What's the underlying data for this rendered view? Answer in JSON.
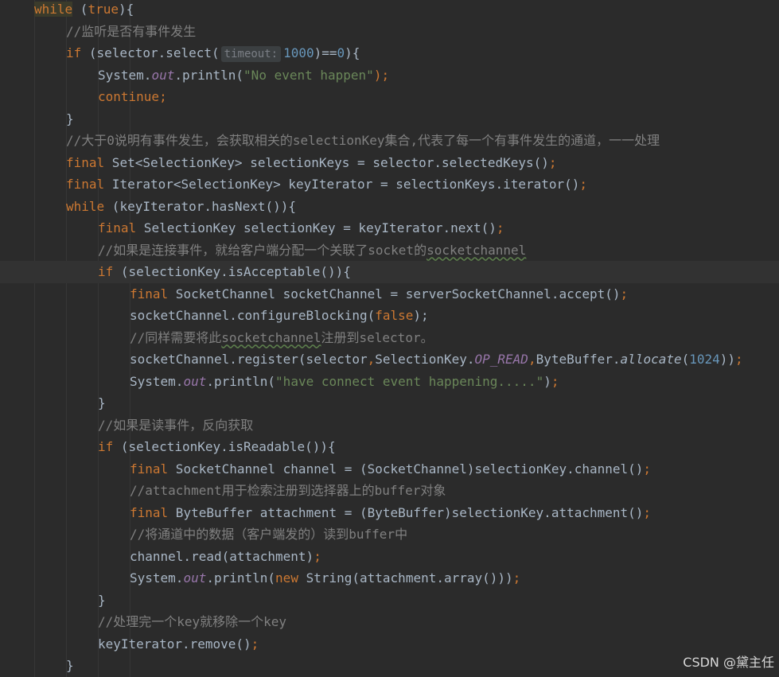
{
  "colors": {
    "background": "#2b2b2b",
    "keyword": "#cc7832",
    "string": "#6a8759",
    "number": "#6897bb",
    "comment": "#808080",
    "field": "#9876aa",
    "default": "#a9b7c6"
  },
  "watermark": "CSDN @黛主任",
  "lines": [
    {
      "indent": 1,
      "tokens": [
        {
          "t": "while",
          "c": "k kwhl"
        },
        {
          "t": " (",
          "c": ""
        },
        {
          "t": "true",
          "c": "k"
        },
        {
          "t": "){",
          "c": ""
        }
      ]
    },
    {
      "indent": 2,
      "tokens": [
        {
          "t": "//监听是否有事件发生",
          "c": "c"
        }
      ]
    },
    {
      "indent": 2,
      "tokens": [
        {
          "t": "if",
          "c": "k"
        },
        {
          "t": " (selector.select(",
          "c": ""
        },
        {
          "t": "timeout:",
          "c": "hint"
        },
        {
          "t": "1000",
          "c": "n"
        },
        {
          "t": ")==",
          "c": ""
        },
        {
          "t": "0",
          "c": "n"
        },
        {
          "t": "){",
          "c": ""
        }
      ]
    },
    {
      "indent": 3,
      "tokens": [
        {
          "t": "System.",
          "c": ""
        },
        {
          "t": "out",
          "c": "f"
        },
        {
          "t": ".println(",
          "c": ""
        },
        {
          "t": "\"No event happen\"",
          "c": "s"
        },
        {
          "t": ");",
          "c": "k"
        }
      ]
    },
    {
      "indent": 3,
      "tokens": [
        {
          "t": "continue",
          "c": "k"
        },
        {
          "t": ";",
          "c": "k"
        }
      ]
    },
    {
      "indent": 2,
      "tokens": [
        {
          "t": "}",
          "c": ""
        }
      ]
    },
    {
      "indent": 2,
      "tokens": [
        {
          "t": "//大于0说明有事件发生，会获取相关的selectionKey集合,代表了每一个有事件发生的通道，一一处理",
          "c": "c"
        }
      ]
    },
    {
      "indent": 2,
      "tokens": [
        {
          "t": "final",
          "c": "k"
        },
        {
          "t": " Set<SelectionKey> selectionKeys = selector.selectedKeys()",
          "c": ""
        },
        {
          "t": ";",
          "c": "k"
        }
      ]
    },
    {
      "indent": 2,
      "tokens": [
        {
          "t": "final",
          "c": "k"
        },
        {
          "t": " Iterator<SelectionKey> keyIterator = selectionKeys.iterator()",
          "c": ""
        },
        {
          "t": ";",
          "c": "k"
        }
      ]
    },
    {
      "indent": 2,
      "tokens": [
        {
          "t": "while",
          "c": "k"
        },
        {
          "t": " (keyIterator.hasNext()){",
          "c": ""
        }
      ]
    },
    {
      "indent": 3,
      "tokens": [
        {
          "t": "final",
          "c": "k"
        },
        {
          "t": " SelectionKey selectionKey = keyIterator.next()",
          "c": ""
        },
        {
          "t": ";",
          "c": "k"
        }
      ]
    },
    {
      "indent": 3,
      "tokens": [
        {
          "t": "//如果是连接事件，就给客户端分配一个关联了socket的",
          "c": "c"
        },
        {
          "t": "socketchannel",
          "c": "c typo"
        }
      ]
    },
    {
      "indent": 3,
      "current": true,
      "tokens": [
        {
          "t": "if",
          "c": "k"
        },
        {
          "t": " (selectionKey.isAcceptable()){",
          "c": ""
        }
      ]
    },
    {
      "indent": 4,
      "tokens": [
        {
          "t": "final",
          "c": "k"
        },
        {
          "t": " SocketChannel socketChannel = serverSocketChannel.accept()",
          "c": ""
        },
        {
          "t": ";",
          "c": "k"
        }
      ]
    },
    {
      "indent": 4,
      "tokens": [
        {
          "t": "socketChannel.configureBlocking(",
          "c": ""
        },
        {
          "t": "false",
          "c": "k"
        },
        {
          "t": ");",
          "c": ""
        }
      ]
    },
    {
      "indent": 4,
      "tokens": [
        {
          "t": "//同样需要将此",
          "c": "c"
        },
        {
          "t": "socketchannel",
          "c": "c typo"
        },
        {
          "t": "注册到selector。",
          "c": "c"
        }
      ]
    },
    {
      "indent": 4,
      "tokens": [
        {
          "t": "socketChannel.register(selector",
          "c": ""
        },
        {
          "t": ",",
          "c": "k"
        },
        {
          "t": "SelectionKey.",
          "c": ""
        },
        {
          "t": "OP_READ",
          "c": "sf"
        },
        {
          "t": ",",
          "c": "k"
        },
        {
          "t": "ByteBuffer.",
          "c": ""
        },
        {
          "t": "allocate",
          "c": "sm"
        },
        {
          "t": "(",
          "c": ""
        },
        {
          "t": "1024",
          "c": "n"
        },
        {
          "t": "))",
          "c": ""
        },
        {
          "t": ";",
          "c": "k"
        }
      ]
    },
    {
      "indent": 4,
      "tokens": [
        {
          "t": "System.",
          "c": ""
        },
        {
          "t": "out",
          "c": "f"
        },
        {
          "t": ".println(",
          "c": ""
        },
        {
          "t": "\"have connect event happening.....\"",
          "c": "s"
        },
        {
          "t": ")",
          "c": ""
        },
        {
          "t": ";",
          "c": "k"
        }
      ]
    },
    {
      "indent": 3,
      "tokens": [
        {
          "t": "}",
          "c": ""
        }
      ]
    },
    {
      "indent": 3,
      "tokens": [
        {
          "t": "//如果是读事件，反向获取",
          "c": "c"
        }
      ]
    },
    {
      "indent": 3,
      "tokens": [
        {
          "t": "if",
          "c": "k"
        },
        {
          "t": " (selectionKey.isReadable()){",
          "c": ""
        }
      ]
    },
    {
      "indent": 4,
      "tokens": [
        {
          "t": "final",
          "c": "k"
        },
        {
          "t": " SocketChannel channel = (SocketChannel)selectionKey.channel()",
          "c": ""
        },
        {
          "t": ";",
          "c": "k"
        }
      ]
    },
    {
      "indent": 4,
      "tokens": [
        {
          "t": "//attachment用于检索注册到选择器上的buffer对象",
          "c": "c"
        }
      ]
    },
    {
      "indent": 4,
      "tokens": [
        {
          "t": "final",
          "c": "k"
        },
        {
          "t": " ByteBuffer attachment = (ByteBuffer)selectionKey.attachment()",
          "c": ""
        },
        {
          "t": ";",
          "c": "k"
        }
      ]
    },
    {
      "indent": 4,
      "tokens": [
        {
          "t": "//将通道中的数据（客户端发的）读到buffer中",
          "c": "c"
        }
      ]
    },
    {
      "indent": 4,
      "tokens": [
        {
          "t": "channel.read(attachment)",
          "c": ""
        },
        {
          "t": ";",
          "c": "k"
        }
      ]
    },
    {
      "indent": 4,
      "tokens": [
        {
          "t": "System.",
          "c": ""
        },
        {
          "t": "out",
          "c": "f"
        },
        {
          "t": ".println(",
          "c": ""
        },
        {
          "t": "new",
          "c": "k"
        },
        {
          "t": " String(attachment.array()))",
          "c": ""
        },
        {
          "t": ";",
          "c": "k"
        }
      ]
    },
    {
      "indent": 3,
      "tokens": [
        {
          "t": "}",
          "c": ""
        }
      ]
    },
    {
      "indent": 3,
      "tokens": [
        {
          "t": "//处理完一个key就移除一个key",
          "c": "c"
        }
      ]
    },
    {
      "indent": 3,
      "tokens": [
        {
          "t": "keyIterator.remove()",
          "c": ""
        },
        {
          "t": ";",
          "c": "k"
        }
      ]
    },
    {
      "indent": 2,
      "tokens": [
        {
          "t": "}",
          "c": ""
        }
      ]
    }
  ]
}
